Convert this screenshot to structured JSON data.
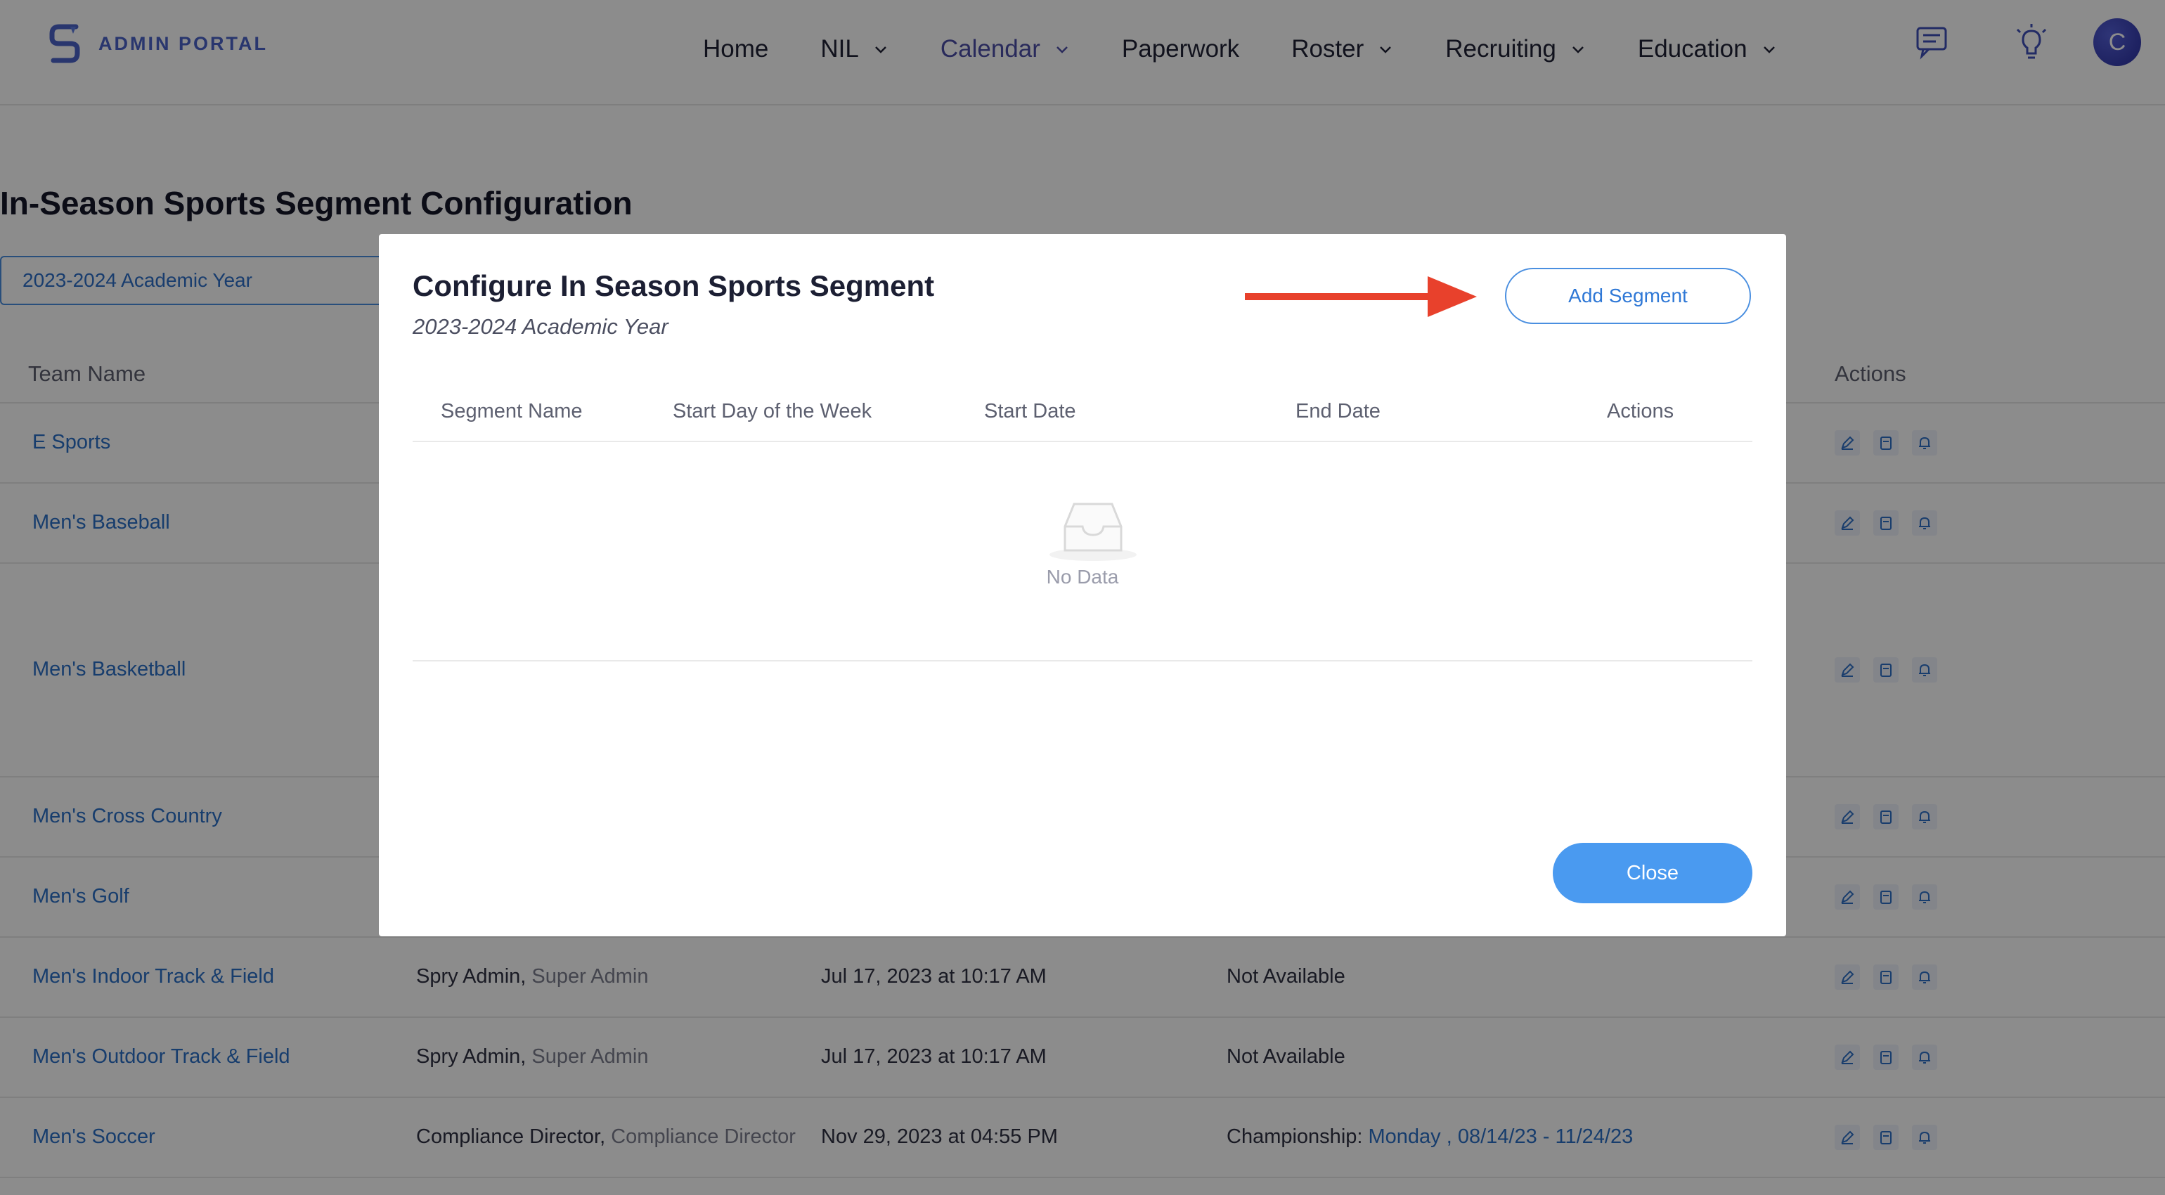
{
  "brand": {
    "name": "ADMIN PORTAL"
  },
  "nav": {
    "items": [
      {
        "label": "Home"
      },
      {
        "label": "NIL"
      },
      {
        "label": "Calendar"
      },
      {
        "label": "Paperwork"
      },
      {
        "label": "Roster"
      },
      {
        "label": "Recruiting"
      },
      {
        "label": "Education"
      }
    ],
    "active": "Calendar",
    "user_initial": "C"
  },
  "page": {
    "title": "In-Season Sports Segment Configuration",
    "year_selector": "2023-2024 Academic Year"
  },
  "table": {
    "headers": {
      "team": "Team Name",
      "actions": "Actions"
    },
    "rows": [
      {
        "team": "E Sports"
      },
      {
        "team": "Men's Baseball"
      },
      {
        "team": "Men's Basketball"
      },
      {
        "team": "Men's Cross Country"
      },
      {
        "team": "Men's Golf"
      },
      {
        "team": "Men's Indoor Track & Field",
        "by_name": "Spry Admin,",
        "by_role": "Super Admin",
        "date": "Jul 17, 2023 at 10:17 AM",
        "status": "Not Available"
      },
      {
        "team": "Men's Outdoor Track & Field",
        "by_name": "Spry Admin,",
        "by_role": "Super Admin",
        "date": "Jul 17, 2023 at 10:17 AM",
        "status": "Not Available"
      },
      {
        "team": "Men's Soccer",
        "by_name": "Compliance Director,",
        "by_role": "Compliance Director",
        "date": "Nov 29, 2023 at 04:55 PM",
        "status_label": "Championship:",
        "status_value": "Monday , 08/14/23 - 11/24/23"
      }
    ]
  },
  "modal": {
    "title": "Configure In Season Sports Segment",
    "subtitle": "2023-2024 Academic Year",
    "add_button": "Add Segment",
    "columns": {
      "segment_name": "Segment Name",
      "start_day": "Start Day of the Week",
      "start_date": "Start Date",
      "end_date": "End Date",
      "actions": "Actions"
    },
    "empty_text": "No Data",
    "close_button": "Close"
  },
  "colors": {
    "brand": "#4b63c9",
    "link": "#2b6fc6",
    "primary_button": "#4a9af0",
    "annotation_arrow": "#e8412c",
    "overlay": "rgba(0,0,0,0.45)"
  }
}
